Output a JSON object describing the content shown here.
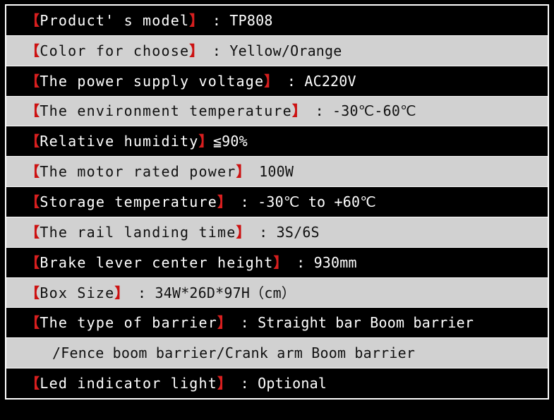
{
  "page": {
    "background_color": "#000000",
    "table_border_color": "#ffffff",
    "dark_row_bg": "#000000",
    "dark_row_text": "#ffffff",
    "light_row_bg": "#d1d1d1",
    "light_row_text": "#111111",
    "bracket_color": "#d81f1f",
    "title": "Product Specification Table"
  },
  "spec_rows": [
    {
      "index": 0,
      "theme": "dark",
      "bracket_open": "【",
      "label": "Product' s model",
      "bracket_close": "】",
      "value": " : TP808",
      "full_text": "【Product' s model】 : TP808"
    },
    {
      "index": 1,
      "theme": "light",
      "bracket_open": "【",
      "label": "Color for choose",
      "bracket_close": "】",
      "value": " : Yellow/Orange",
      "full_text": "【Color for choose】 : Yellow/Orange"
    },
    {
      "index": 2,
      "theme": "dark",
      "bracket_open": "【",
      "label": "The power supply voltage",
      "bracket_close": "】",
      "value": " : AC220V",
      "full_text": "【The power supply voltage】 : AC220V"
    },
    {
      "index": 3,
      "theme": "light",
      "bracket_open": "【",
      "label": "The environment temperature",
      "bracket_close": "】",
      "value": " : -30℃-60℃",
      "full_text": "【The environment temperature】 : -30℃-60℃"
    },
    {
      "index": 4,
      "theme": "dark",
      "bracket_open": "【",
      "label": "Relative humidity",
      "bracket_close": "】",
      "value": "≦90%",
      "full_text": "【Relative humidity】≦90%"
    },
    {
      "index": 5,
      "theme": "light",
      "bracket_open": "【",
      "label": "The motor rated power",
      "bracket_close": "】",
      "value": " 100W",
      "full_text": "【The motor rated power】 100W"
    },
    {
      "index": 6,
      "theme": "dark",
      "bracket_open": "【",
      "label": "Storage temperature",
      "bracket_close": "】",
      "value": " : -30℃ to +60℃",
      "full_text": "【Storage temperature】 : -30℃ to +60℃"
    },
    {
      "index": 7,
      "theme": "light",
      "bracket_open": "【",
      "label": "The rail landing time",
      "bracket_close": "】",
      "value": " : 3S/6S",
      "full_text": "【The rail landing time】 : 3S/6S"
    },
    {
      "index": 8,
      "theme": "dark",
      "bracket_open": "【",
      "label": "Brake lever center height",
      "bracket_close": "】",
      "value": " : 930mm",
      "full_text": "【Brake lever center height】 : 930mm"
    },
    {
      "index": 9,
      "theme": "light",
      "bracket_open": "【",
      "label": "Box Size",
      "bracket_close": "】",
      "value": " : 34W*26D*97H（cm）",
      "full_text": "【Box Size】 : 34W*26D*97H（cm）"
    },
    {
      "index": 10,
      "theme": "dark",
      "bracket_open": "【",
      "label": "The type of barrier",
      "bracket_close": "】",
      "value": " : Straight bar Boom barrier",
      "full_text": "【The type of barrier】 : Straight bar Boom barrier"
    },
    {
      "index": 11,
      "theme": "light",
      "bracket_open": "",
      "label": "",
      "bracket_close": "",
      "value": "/Fence boom barrier/Crank arm Boom barrier",
      "full_text": "/Fence boom barrier/Crank arm Boom barrier",
      "indented": true
    },
    {
      "index": 12,
      "theme": "dark",
      "bracket_open": "【",
      "label": "Led indicator light",
      "bracket_close": "】",
      "value": " : Optional",
      "full_text": "【Led indicator light】 : Optional"
    }
  ]
}
